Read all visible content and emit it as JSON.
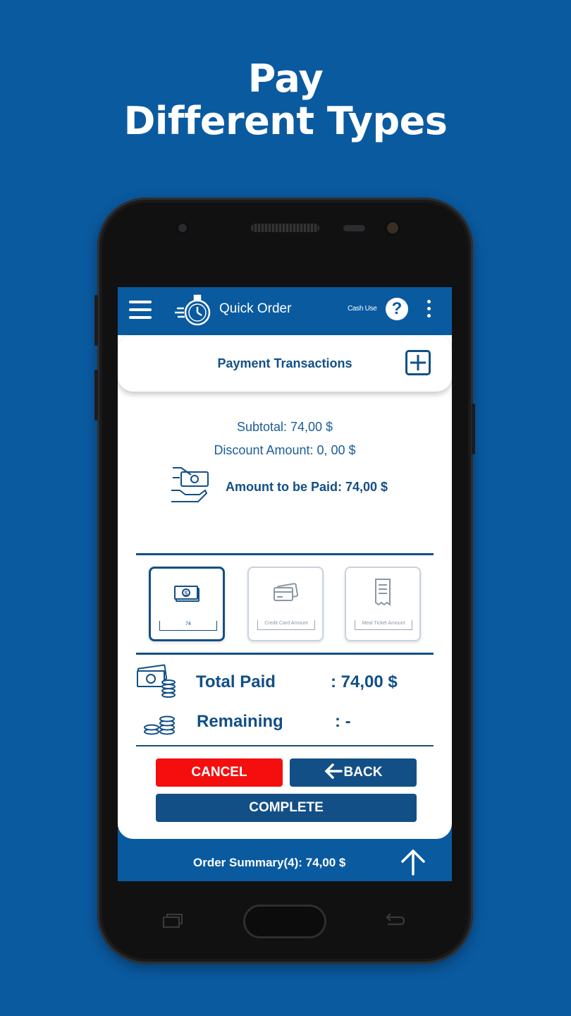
{
  "promo": {
    "title_line1": "Pay",
    "title_line2": "Different Types"
  },
  "appbar": {
    "title": "Quick Order",
    "cash_use": "Cash Use",
    "help": "?"
  },
  "payment": {
    "header": "Payment Transactions",
    "subtotal": "Subtotal: 74,00 $",
    "discount": "Discount Amount: 0, 00 $",
    "amount_due": "Amount to be Paid: 74,00 $"
  },
  "methods": [
    {
      "label": "74",
      "icon": "cash-icon",
      "selected": true
    },
    {
      "label": "Credit Card Amount",
      "icon": "credit-card-icon",
      "selected": false
    },
    {
      "label": "Meal Ticket Amount",
      "icon": "meal-ticket-icon",
      "selected": false
    }
  ],
  "totals": {
    "total_label": "Total Paid",
    "total_value": ": 74,00 $",
    "remaining_label": "Remaining",
    "remaining_value": ": -"
  },
  "buttons": {
    "cancel": "CANCEL",
    "back": "BACK",
    "complete": "COMPLETE"
  },
  "footer": {
    "order_summary": "Order Summary(4): 74,00 $"
  },
  "colors": {
    "brand": "#0a5aa0",
    "dark_blue": "#124f86",
    "cancel_red": "#f50e0e"
  }
}
